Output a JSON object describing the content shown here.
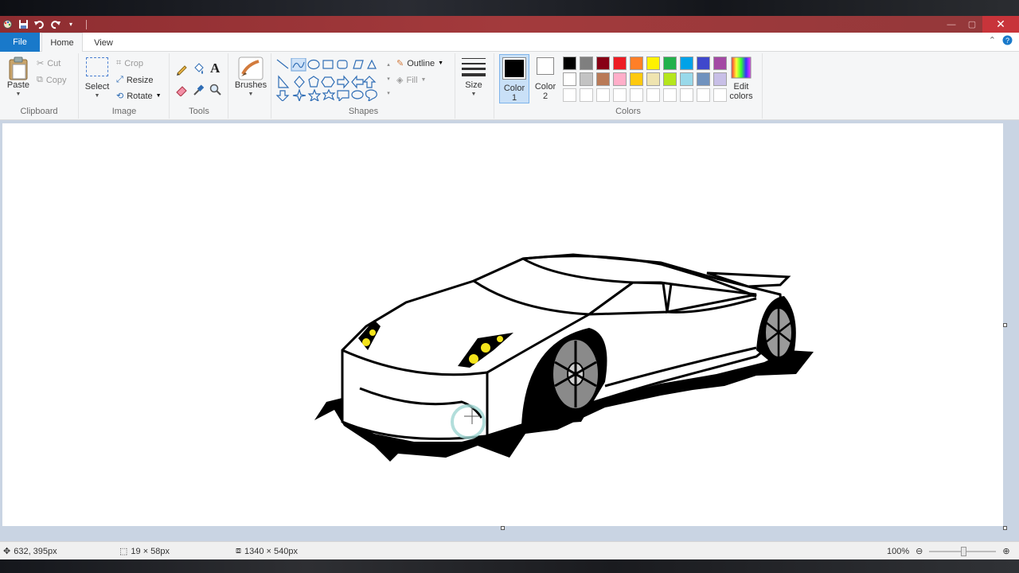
{
  "window": {
    "minimize": "—",
    "maximize": "▢",
    "close": "✕"
  },
  "tabs": {
    "file": "File",
    "home": "Home",
    "view": "View"
  },
  "clipboard": {
    "paste": "Paste",
    "cut": "Cut",
    "copy": "Copy",
    "label": "Clipboard"
  },
  "image": {
    "select": "Select",
    "crop": "Crop",
    "resize": "Resize",
    "rotate": "Rotate",
    "label": "Image"
  },
  "tools": {
    "label": "Tools",
    "text": "A"
  },
  "brushes": {
    "label": "Brushes"
  },
  "shapes": {
    "outline": "Outline",
    "fill": "Fill",
    "label": "Shapes"
  },
  "size": {
    "label": "Size"
  },
  "colors": {
    "color1": "Color 1",
    "color1_line1": "Color",
    "color1_line2": "1",
    "color2_line1": "Color",
    "color2_line2": "2",
    "edit_line1": "Edit",
    "edit_line2": "colors",
    "label": "Colors",
    "row1": [
      "#000000",
      "#7f7f7f",
      "#880015",
      "#ed1c24",
      "#ff7f27",
      "#fff200",
      "#22b14c",
      "#00a2e8",
      "#3f48cc",
      "#a349a4"
    ],
    "row2": [
      "#ffffff",
      "#c3c3c3",
      "#b97a57",
      "#ffaec9",
      "#ffc90e",
      "#efe4b0",
      "#b5e61d",
      "#99d9ea",
      "#7092be",
      "#c8bfe7"
    ]
  },
  "status": {
    "cursor_pos": "632, 395px",
    "selection_size": "19 × 58px",
    "image_size": "1340 × 540px",
    "zoom": "100%"
  }
}
